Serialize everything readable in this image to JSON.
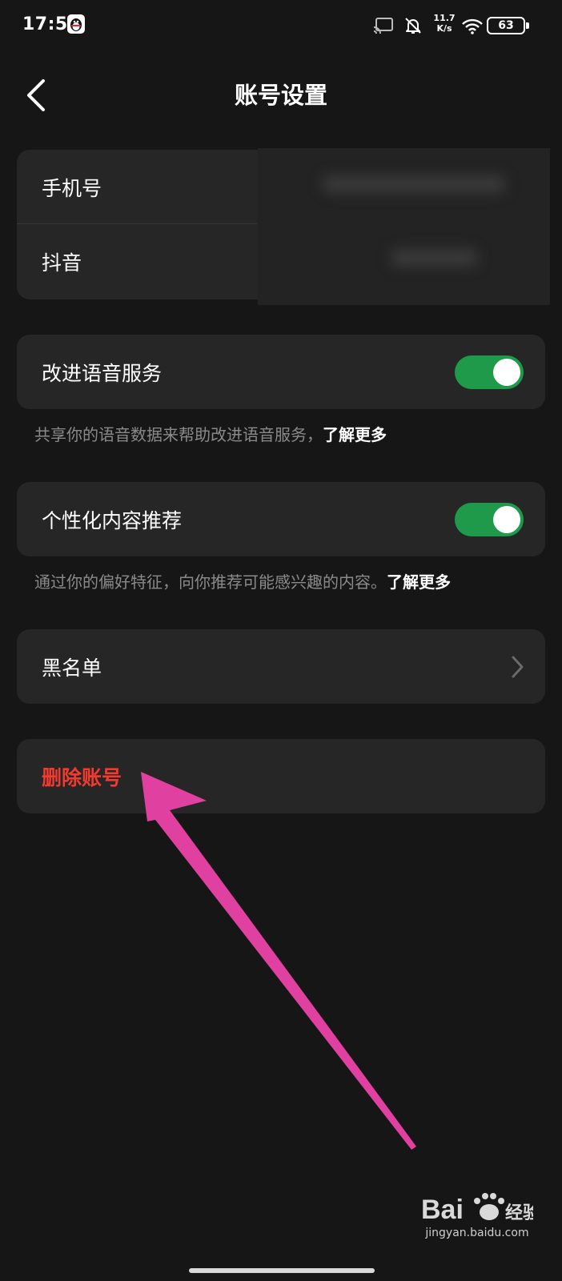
{
  "status_bar": {
    "time": "17:59",
    "net_speed_value": "11.7",
    "net_speed_unit": "K/s",
    "battery": "63",
    "icons": [
      "qq-icon",
      "cast-icon",
      "bell-off-icon",
      "wifi-icon",
      "battery-icon"
    ]
  },
  "nav": {
    "back_icon": "chevron-left-icon",
    "title": "账号设置"
  },
  "account": {
    "phone_label": "手机号",
    "douyin_label": "抖音"
  },
  "voice": {
    "label": "改进语音服务",
    "enabled": true,
    "hint": "共享你的语音数据来帮助改进语音服务，",
    "hint_link": "了解更多"
  },
  "personalized": {
    "label": "个性化内容推荐",
    "enabled": true,
    "hint": "通过你的偏好特征，向你推荐可能感兴趣的内容。",
    "hint_link": "了解更多"
  },
  "blacklist": {
    "label": "黑名单",
    "icon": "chevron-right-icon"
  },
  "delete_account": {
    "label": "删除账号"
  },
  "watermark": {
    "text": "jingyan.baidu.com"
  },
  "colors": {
    "background": "#161616",
    "card": "#262626",
    "toggle_on": "#1f9a4b",
    "danger": "#f23b2e",
    "hint": "#8a8a8a",
    "annotation": "#e040a0"
  }
}
